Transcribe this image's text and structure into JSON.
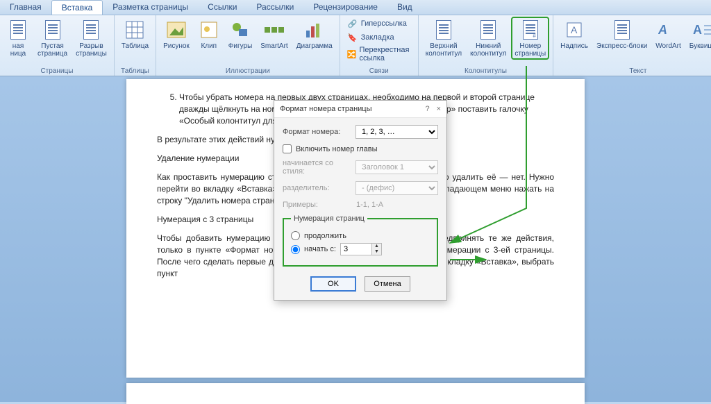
{
  "tabs": [
    "Главная",
    "Вставка",
    "Разметка страницы",
    "Ссылки",
    "Рассылки",
    "Рецензирование",
    "Вид"
  ],
  "active_tab": 1,
  "ribbon": {
    "pages": {
      "label": "Страницы",
      "items": [
        {
          "name": "cover-page",
          "label": "ная\nница"
        },
        {
          "name": "blank-page",
          "label": "Пустая\nстраница"
        },
        {
          "name": "page-break",
          "label": "Разрыв\nстраницы"
        }
      ]
    },
    "tables": {
      "label": "Таблицы",
      "items": [
        {
          "name": "table",
          "label": "Таблица"
        }
      ]
    },
    "illus": {
      "label": "Иллюстрации",
      "items": [
        {
          "name": "picture",
          "label": "Рисунок"
        },
        {
          "name": "clip",
          "label": "Клип"
        },
        {
          "name": "shapes",
          "label": "Фигуры"
        },
        {
          "name": "smartart",
          "label": "SmartArt"
        },
        {
          "name": "chart",
          "label": "Диаграмма"
        }
      ]
    },
    "links": {
      "label": "Связи",
      "items": [
        {
          "name": "hyperlink",
          "label": "Гиперссылка"
        },
        {
          "name": "bookmark",
          "label": "Закладка"
        },
        {
          "name": "crossref",
          "label": "Перекрестная ссылка"
        }
      ]
    },
    "hdrftr": {
      "label": "Колонтитулы",
      "items": [
        {
          "name": "header",
          "label": "Верхний\nколонтитул"
        },
        {
          "name": "footer",
          "label": "Нижний\nколонтитул"
        },
        {
          "name": "page-number",
          "label": "Номер\nстраницы",
          "highlight": true
        }
      ]
    },
    "text": {
      "label": "Текст",
      "items": [
        {
          "name": "textbox",
          "label": "Надпись"
        },
        {
          "name": "quickparts",
          "label": "Экспресс-блоки"
        },
        {
          "name": "wordart",
          "label": "WordArt"
        },
        {
          "name": "dropcap",
          "label": "Буквица"
        }
      ]
    }
  },
  "document": {
    "li5": "Чтобы убрать номера на первых двух страницах, необходимо на первой и второй странице дважды щёлкнуть на номерах и в появившейся вкладке «Конструктор» поставить галочку «Особый колонтитул для первой страницы».",
    "p1": "В результате этих действий нумерация теперь начинается с 3 страницы.",
    "p2": "Удаление нумерации",
    "p3": "Как проставить нумерацию страниц, мы разобрались, однако, как можно удалить её — нет. Нужно перейти во вкладку «Вставка», выбрать пункт «Номер страницы» и в выпадающем меню нажать на строку \"Удалить номера страниц\".",
    "p4": "Нумерация с 3 страницы",
    "p5": "Чтобы добавить нумерацию с 3 страницы в «Ворде 2007», нужно предпринять те же действия, только в пункте «Формат номеров страниц» нужно выбрать начало нумерации с 3-ей страницы. После чего сделать первые две страницы новыми разделами, войдя во вкладку «Вставка», выбрать пункт"
  },
  "dialog": {
    "title": "Формат номера страницы",
    "help": "?",
    "close": "×",
    "format_label": "Формат номера:",
    "format_value": "1, 2, 3, …",
    "include_chapter": "Включить номер главы",
    "start_style_label": "начинается со стиля:",
    "start_style_value": "Заголовок 1",
    "sep_label": "разделитель:",
    "sep_value": "-   (дефис)",
    "examples_label": "Примеры:",
    "examples_value": "1-1, 1-A",
    "group_label": "Нумерация страниц",
    "radio_continue": "продолжить",
    "radio_startat": "начать с:",
    "startat_value": "3",
    "ok": "OK",
    "cancel": "Отмена"
  }
}
